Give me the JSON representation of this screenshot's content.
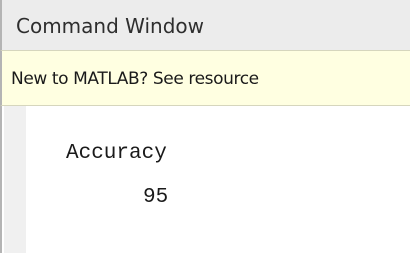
{
  "window": {
    "title": "Command Window"
  },
  "info_bar": {
    "text": "New to MATLAB? See resource"
  },
  "output": {
    "variable_name": "Accuracy",
    "variable_value": "95"
  }
}
